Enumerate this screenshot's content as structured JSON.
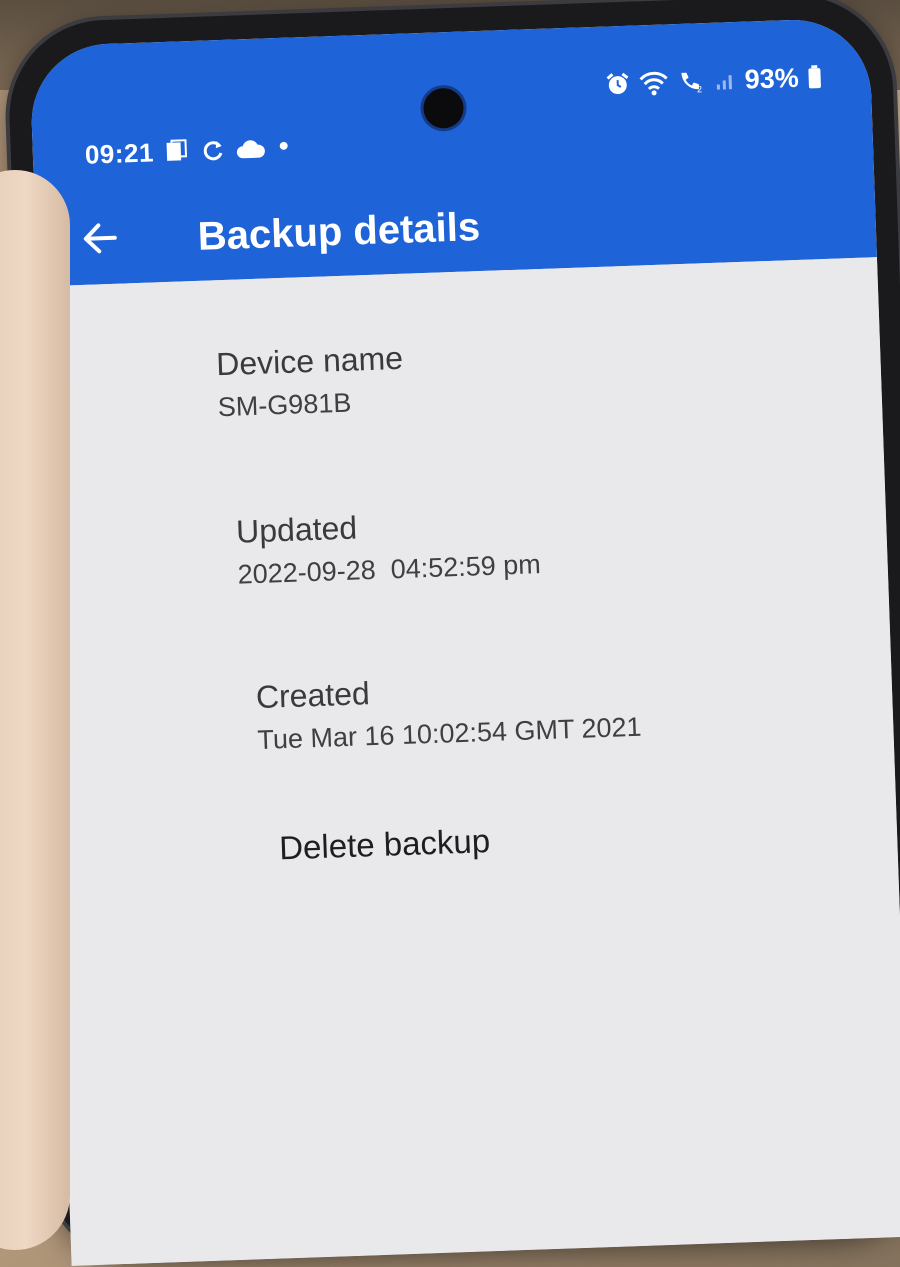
{
  "status_bar": {
    "time": "09:21",
    "battery_percent": "93%",
    "left_icons": [
      "notification-app-icon",
      "sync-icon",
      "cloud-icon",
      "dot-icon"
    ],
    "right_icons": [
      "alarm-icon",
      "wifi-icon",
      "volte-call-icon",
      "signal-icon",
      "battery-icon"
    ]
  },
  "app_bar": {
    "title": "Backup details",
    "back_icon": "back-arrow-icon",
    "color": "#1f63d8"
  },
  "details": {
    "device_name": {
      "label": "Device name",
      "value": "SM-G981B"
    },
    "updated": {
      "label": "Updated",
      "value": "2022-09-28  04:52:59 pm"
    },
    "created": {
      "label": "Created",
      "value": "Tue Mar 16 10:02:54 GMT 2021"
    }
  },
  "actions": {
    "delete_label": "Delete backup"
  }
}
